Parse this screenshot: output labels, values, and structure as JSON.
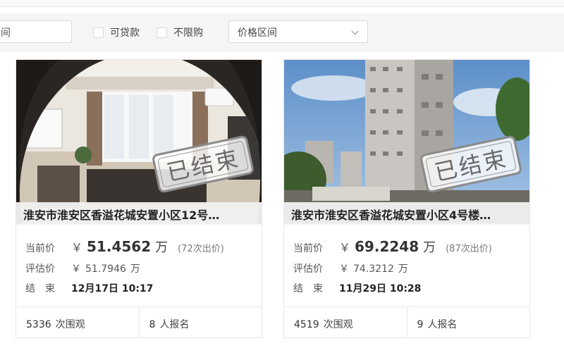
{
  "filters": {
    "range_input_text": "间",
    "loanable_label": "可贷款",
    "unlimited_label": "不限购",
    "price_range_label": "价格区间"
  },
  "listings": [
    {
      "stamp": "已结束",
      "title": "淮安市淮安区香溢花城安置小区12号…",
      "current_label": "当前价",
      "currency": "￥",
      "current_price": "51.4562",
      "unit": "万",
      "bid_count": "(72次出价)",
      "appraise_label": "评估价",
      "appraise_price": "51.7946",
      "end_label": "结　束",
      "end_time": "12月17日 10:17",
      "views_num": "5336",
      "views_label": "次围观",
      "signups_num": "8",
      "signups_label": "人报名"
    },
    {
      "stamp": "已结束",
      "title": "淮安市淮安区香溢花城安置小区4号楼…",
      "current_label": "当前价",
      "currency": "￥",
      "current_price": "69.2248",
      "unit": "万",
      "bid_count": "(87次出价)",
      "appraise_label": "评估价",
      "appraise_price": "74.3212",
      "end_label": "结　束",
      "end_time": "11月29日 10:28",
      "views_num": "4519",
      "views_label": "次围观",
      "signups_num": "9",
      "signups_label": "人报名"
    }
  ]
}
